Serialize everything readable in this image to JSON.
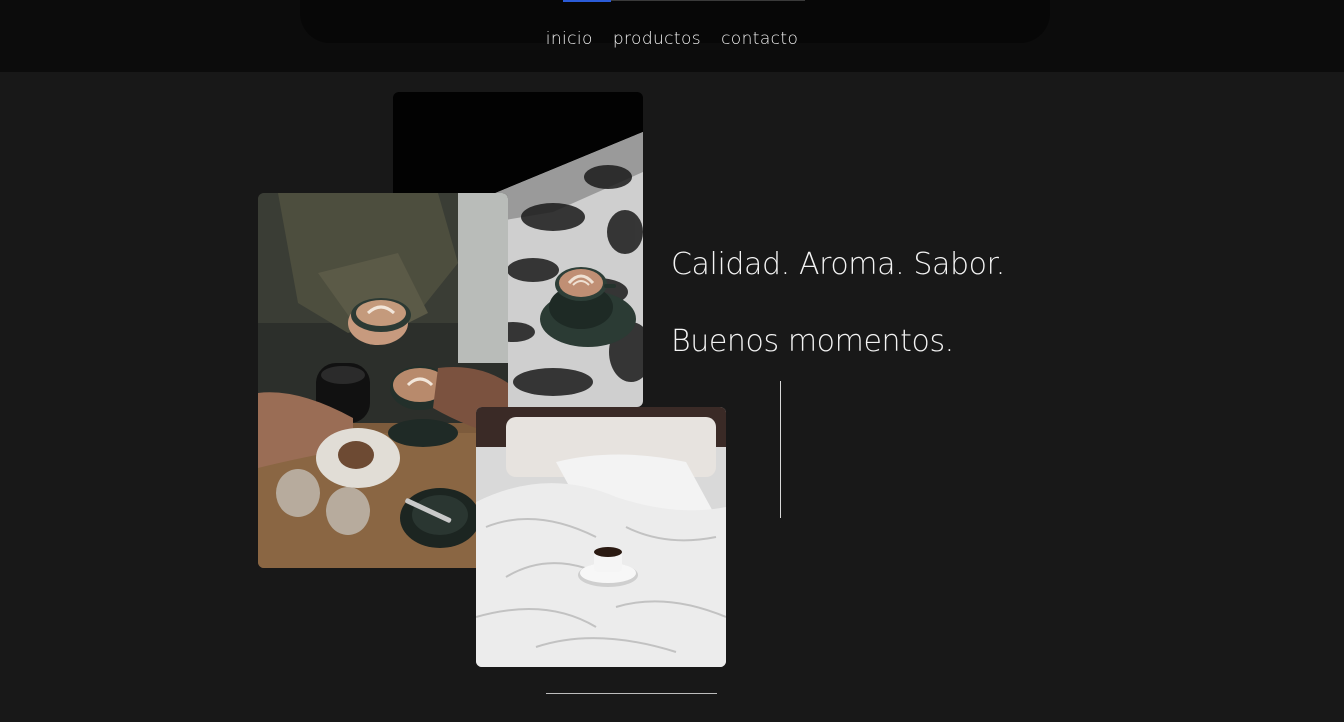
{
  "nav": {
    "items": [
      {
        "label": "inicio"
      },
      {
        "label": "productos"
      },
      {
        "label": "contacto"
      }
    ]
  },
  "hero": {
    "headline_1": "Calidad. Aroma. Sabor.",
    "headline_2": "Buenos momentos."
  },
  "colors": {
    "background": "#181818",
    "topbar": "#0c0c0c",
    "accent": "#2a5bd7",
    "text": "#f3f3f3"
  }
}
